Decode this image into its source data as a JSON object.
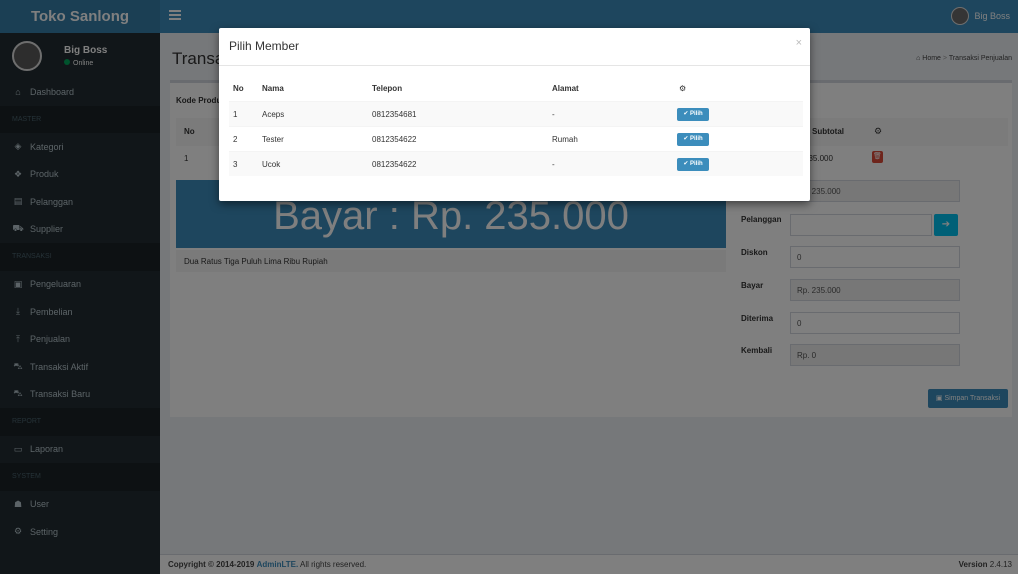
{
  "app": {
    "brand": "Toko Sanlong",
    "user_name": "Big Boss",
    "status": "Online"
  },
  "sidebar": {
    "items": [
      {
        "label": "Dashboard",
        "icon": "dashboard-icon",
        "glyph": "⌂"
      },
      {
        "header": "MASTER"
      },
      {
        "label": "Kategori",
        "icon": "tag-icon",
        "glyph": "◈"
      },
      {
        "label": "Produk",
        "icon": "cubes-icon",
        "glyph": "❖"
      },
      {
        "label": "Pelanggan",
        "icon": "id-card-icon",
        "glyph": "▤"
      },
      {
        "label": "Supplier",
        "icon": "truck-icon",
        "glyph": "⛟"
      },
      {
        "header": "TRANSAKSI"
      },
      {
        "label": "Pengeluaran",
        "icon": "money-icon",
        "glyph": "▣"
      },
      {
        "label": "Pembelian",
        "icon": "download-icon",
        "glyph": "⤓"
      },
      {
        "label": "Penjualan",
        "icon": "upload-icon",
        "glyph": "⤒"
      },
      {
        "label": "Transaksi Aktif",
        "icon": "cart-icon",
        "glyph": "⛍"
      },
      {
        "label": "Transaksi Baru",
        "icon": "cart-plus-icon",
        "glyph": "⛍"
      },
      {
        "header": "REPORT"
      },
      {
        "label": "Laporan",
        "icon": "file-icon",
        "glyph": "▭"
      },
      {
        "header": "SYSTEM"
      },
      {
        "label": "User",
        "icon": "users-icon",
        "glyph": "☗"
      },
      {
        "label": "Setting",
        "icon": "cogs-icon",
        "glyph": "⚙"
      }
    ]
  },
  "page": {
    "title": "Transaksi Penjualan",
    "breadcrumb_home": "Home",
    "breadcrumb_current": "Transaksi Penjualan",
    "kode_label": "Kode Produk",
    "table_no_header": "No",
    "row1_no": "1",
    "subtotal_header": "Subtotal",
    "row1_subtotal": "235.000",
    "total_banner": "Bayar : Rp. 235.000",
    "terbilang": "Dua Ratus Tiga Puluh Lima Ribu Rupiah"
  },
  "form": {
    "total_value": "Rp. 235.000",
    "pelanggan_label": "Pelanggan",
    "diskon_label": "Diskon",
    "diskon_value": "0",
    "bayar_label": "Bayar",
    "bayar_value": "Rp. 235.000",
    "diterima_label": "Diterima",
    "diterima_value": "0",
    "kembali_label": "Kembali",
    "kembali_value": "Rp. 0",
    "save_label": "Simpan Transaksi"
  },
  "footer": {
    "copyright_prefix": "Copyright © 2014-2019",
    "brand_link": "AdminLTE.",
    "copyright_suffix": "All rights reserved.",
    "version_label": "Version",
    "version_value": "2.4.13"
  },
  "modal": {
    "title": "Pilih Member",
    "columns": [
      "No",
      "Nama",
      "Telepon",
      "Alamat"
    ],
    "pilih_label": "Pilih",
    "rows": [
      {
        "no": "1",
        "nama": "Aceps",
        "telepon": "0812354681",
        "alamat": "-"
      },
      {
        "no": "2",
        "nama": "Tester",
        "telepon": "0812354622",
        "alamat": "Rumah"
      },
      {
        "no": "3",
        "nama": "Ucok",
        "telepon": "0812354622",
        "alamat": "-"
      }
    ]
  },
  "colors": {
    "primary": "#3c8dbc",
    "sidebar": "#222d32",
    "danger": "#dd4b39",
    "info": "#00c0ef"
  }
}
